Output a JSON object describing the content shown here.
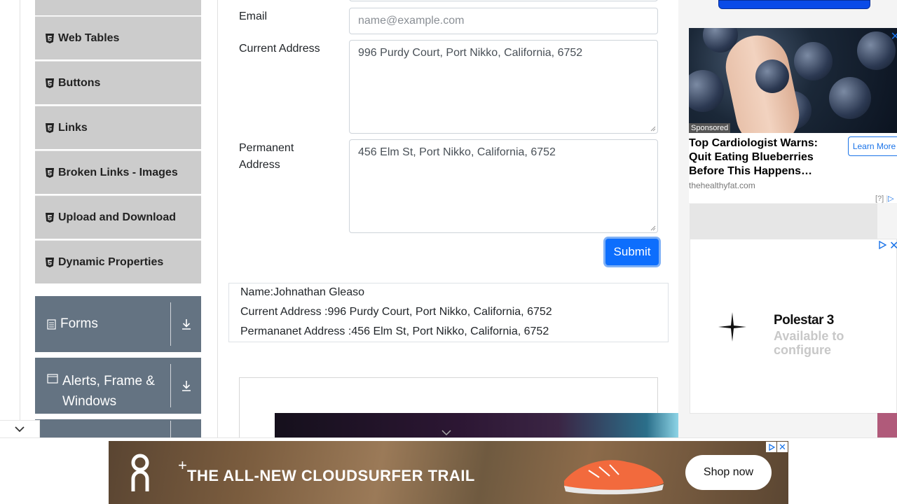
{
  "sidebar": {
    "items": [
      {
        "label": "Web Tables",
        "icon": "html5-icon"
      },
      {
        "label": "Buttons",
        "icon": "html5-icon"
      },
      {
        "label": "Links",
        "icon": "html5-icon"
      },
      {
        "label": "Broken Links - Images",
        "icon": "html5-icon"
      },
      {
        "label": "Upload and Download",
        "icon": "html5-icon"
      },
      {
        "label": "Dynamic Properties",
        "icon": "html5-icon"
      }
    ],
    "groups": [
      {
        "label": "Forms",
        "icon": "document-icon"
      },
      {
        "label": "Alerts, Frame & Windows",
        "icon": "window-icon"
      }
    ]
  },
  "form": {
    "email_label": "Email",
    "email_placeholder": "name@example.com",
    "current_address_label": "Current Address",
    "current_address_value": "996 Purdy Court, Port Nikko, California, 6752",
    "permanent_address_label": "Permanent Address",
    "permanent_address_value": "456 Elm St, Port Nikko, California, 6752",
    "submit_label": "Submit"
  },
  "output": {
    "name": "Name:Johnathan Gleaso",
    "current_address": "Current Address :996 Purdy Court, Port Nikko, California, 6752",
    "permanent_address": "Permananet Address :456 Elm St, Port Nikko, California, 6752"
  },
  "ads": {
    "blueberry": {
      "sponsored": "Sponsored",
      "headline": "Top Cardiologist Warns: Quit Eating Blueberries Before This Happens…",
      "source": "thehealthyfat.com",
      "cta": "Learn More",
      "info": "[?]"
    },
    "polestar": {
      "brand": "Polestar 3",
      "tagline": "Available to configure"
    },
    "banner": {
      "slogan": "THE ALL-NEW CLOUDSURFER TRAIL",
      "cta": "Shop now"
    }
  },
  "colors": {
    "sidebar_item_bg": "#cccccc",
    "group_header_bg": "#647382",
    "submit_bg": "#0d6efd"
  }
}
